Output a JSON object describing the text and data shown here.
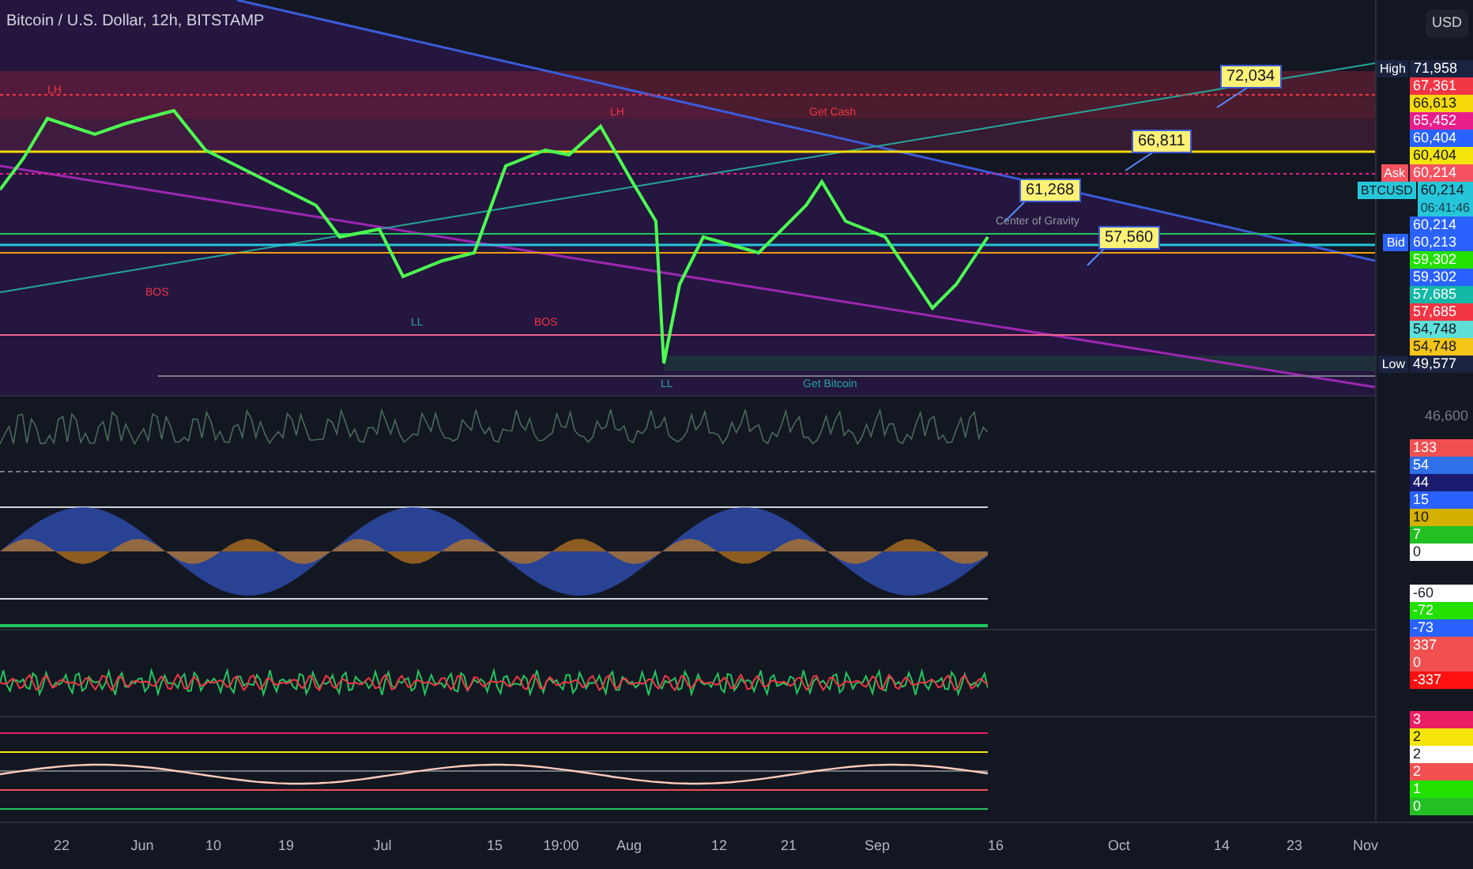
{
  "header": {
    "title": "Bitcoin / U.S. Dollar, 12h, BITSTAMP",
    "currency_button": "USD"
  },
  "chart_labels": [
    {
      "text": "LH",
      "color": "#f23645"
    },
    {
      "text": "LH",
      "color": "#f23645"
    },
    {
      "text": "Get Cash",
      "color": "#f23645"
    },
    {
      "text": "BOS",
      "color": "#f23645"
    },
    {
      "text": "BOS",
      "color": "#f23645"
    },
    {
      "text": "LL",
      "color": "#26a69a"
    },
    {
      "text": "LL",
      "color": "#26a69a"
    },
    {
      "text": "Get Bitcoin",
      "color": "#26a69a"
    },
    {
      "text": "Center of Gravity",
      "color": "#9598a1"
    }
  ],
  "callouts": [
    "72,034",
    "66,811",
    "61,268",
    "57,560"
  ],
  "price_axis": [
    {
      "value": "71,958",
      "color": "#1a2340",
      "tag": "High"
    },
    {
      "value": "67,361",
      "color": "#f23645"
    },
    {
      "value": "66,613",
      "color": "#f5d90a"
    },
    {
      "value": "65,452",
      "color": "#e91e8c"
    },
    {
      "value": "60,404",
      "color": "#2962ff"
    },
    {
      "value": "60,404",
      "color": "#f5e50a"
    },
    {
      "value": "60,214",
      "color": "#f7525f",
      "tag": "Ask"
    },
    {
      "value": "60,214",
      "color": "#26c6da",
      "tag": "BTCUSD",
      "subtext": "06:41:46"
    },
    {
      "value": "60,214",
      "color": "#2962ff"
    },
    {
      "value": "60,213",
      "color": "#2962ff",
      "tag": "Bid"
    },
    {
      "value": "59,302",
      "color": "#22e000"
    },
    {
      "value": "59,302",
      "color": "#2962ff"
    },
    {
      "value": "57,685",
      "color": "#14b8a6"
    },
    {
      "value": "57,685",
      "color": "#f23645"
    },
    {
      "value": "54,748",
      "color": "#5ee0d8"
    },
    {
      "value": "54,748",
      "color": "#f5c518"
    },
    {
      "value": "49,577",
      "color": "#1a2340",
      "tag": "Low"
    }
  ],
  "volume_axis": [
    "46,600"
  ],
  "oscillator_axes": [
    [
      {
        "value": "133",
        "color": "#f05050"
      },
      {
        "value": "54",
        "color": "#2f6fe8"
      },
      {
        "value": "44",
        "color": "#1a1a6e"
      },
      {
        "value": "15",
        "color": "#2962ff"
      },
      {
        "value": "10",
        "color": "#d4b000"
      },
      {
        "value": "7",
        "color": "#22c022"
      },
      {
        "value": "0",
        "color": "#ffffff"
      }
    ],
    [
      {
        "value": "-60",
        "color": "#ffffff"
      },
      {
        "value": "-72",
        "color": "#22e000"
      },
      {
        "value": "-73",
        "color": "#2962ff"
      },
      {
        "value": "337",
        "color": "#f05050"
      },
      {
        "value": "0",
        "color": "#f05050"
      },
      {
        "value": "-337",
        "color": "#ff1010"
      }
    ],
    [
      {
        "value": "3",
        "color": "#e91e63"
      },
      {
        "value": "2",
        "color": "#f5e50a"
      },
      {
        "value": "2",
        "color": "#ffffff"
      },
      {
        "value": "2",
        "color": "#f05050"
      },
      {
        "value": "1",
        "color": "#22e000"
      },
      {
        "value": "0",
        "color": "#22c022"
      }
    ]
  ],
  "time_axis": [
    "22",
    "Jun",
    "10",
    "19",
    "Jul",
    "15",
    "19:00",
    "Aug",
    "12",
    "21",
    "Sep",
    "16",
    "Oct",
    "14",
    "23",
    "Nov"
  ]
}
